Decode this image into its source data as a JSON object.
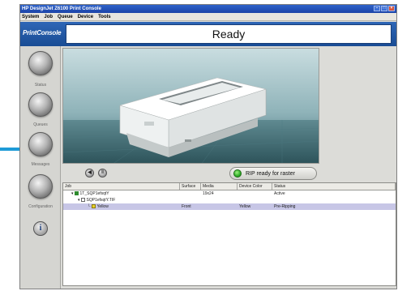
{
  "window": {
    "title": "HP DesignJet Z6100 Print Console",
    "controls": [
      "minimize-icon",
      "maximize-icon",
      "close-icon"
    ]
  },
  "menu": [
    "System",
    "Job",
    "Queue",
    "Device",
    "Tools"
  ],
  "header": {
    "logo": "PrintConsole",
    "status": "Ready"
  },
  "sidebar": {
    "items": [
      {
        "label": "Status"
      },
      {
        "label": "Queues"
      },
      {
        "label": "Messages"
      },
      {
        "label": "Configuration"
      }
    ],
    "info_icon": "i"
  },
  "toolbar": {
    "buttons": [
      "prev-icon",
      "pause-icon"
    ],
    "rip_status": "RIP ready for raster",
    "rip_color": "#2fae27"
  },
  "table": {
    "columns": [
      "Job",
      "Surface",
      "Media",
      "Device Color",
      "Status"
    ],
    "rows": [
      {
        "job": "1T_SQP1efsqtY",
        "surface": "",
        "media": "19x24",
        "color": "",
        "status": "Active",
        "level": 0
      },
      {
        "job": "SQP1efsqtY.TIF",
        "surface": "",
        "media": "",
        "color": "",
        "status": "",
        "level": 1
      },
      {
        "job": "Yellow",
        "surface": "Front",
        "media": "",
        "color": "Yellow",
        "status": "Pre-Ripping",
        "level": 2
      }
    ]
  },
  "colors": {
    "header_blue": "#2e66b6",
    "accent_blue": "#1e9bd7",
    "selected_row": "#c7c6e6"
  }
}
